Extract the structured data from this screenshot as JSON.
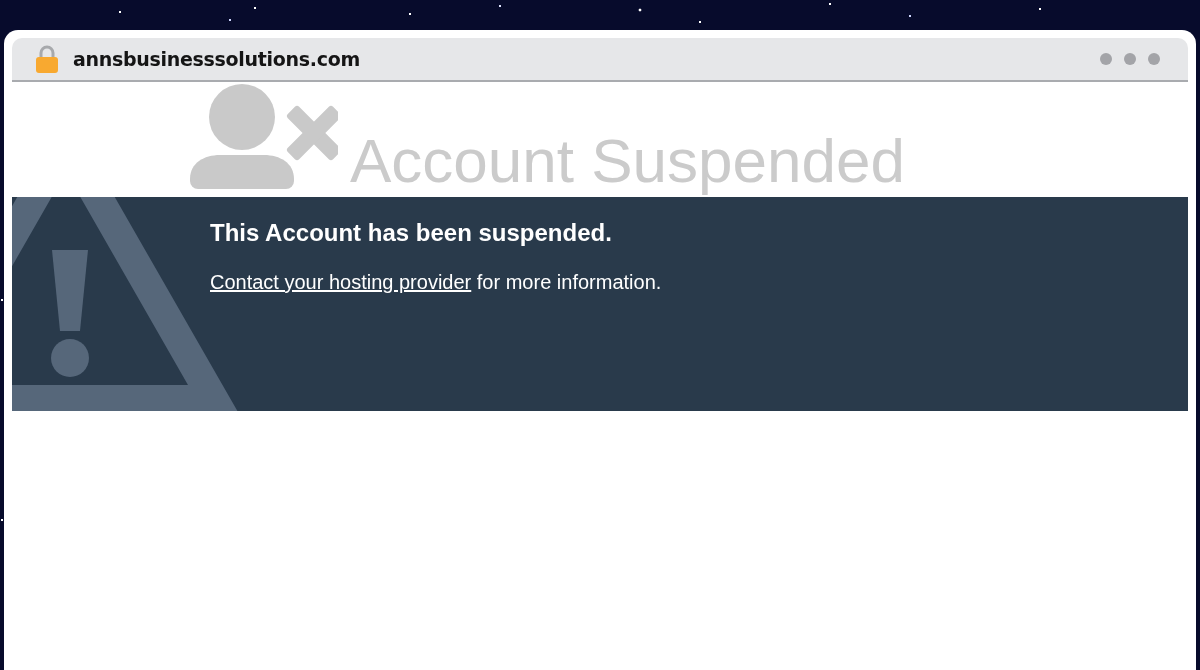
{
  "browser": {
    "url": "annsbusinesssolutions.com"
  },
  "page": {
    "title": "Account Suspended",
    "notice": {
      "heading": "This Account has been suspended.",
      "link_text": "Contact your hosting provider",
      "text_after_link": "for more information."
    }
  }
}
